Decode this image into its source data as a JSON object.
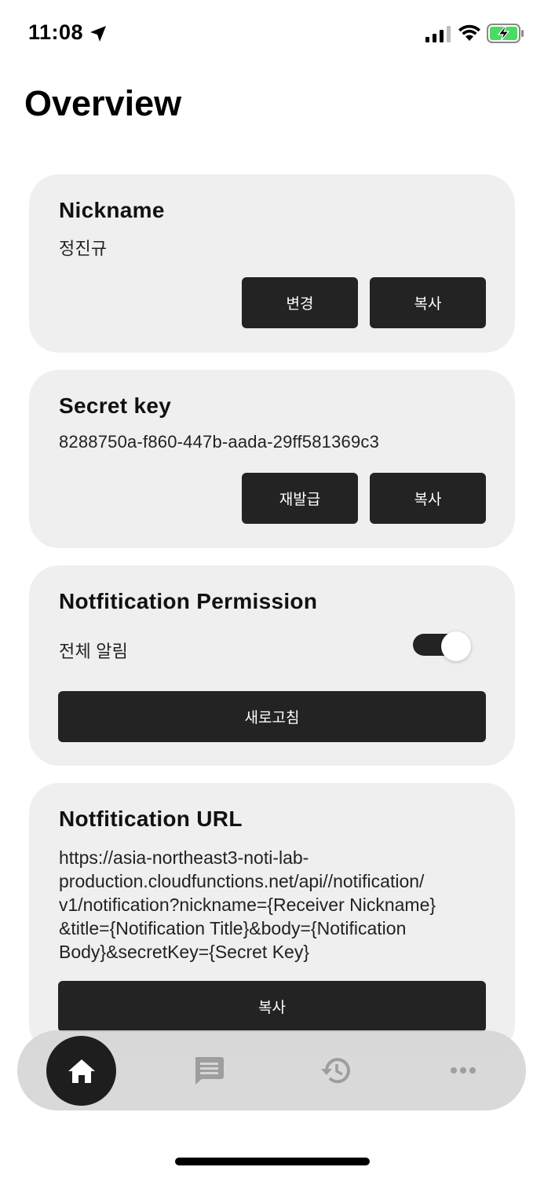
{
  "status_bar": {
    "time": "11:08"
  },
  "page_title": "Overview",
  "nickname_card": {
    "title": "Nickname",
    "value": "정진규",
    "change_label": "변경",
    "copy_label": "복사"
  },
  "secret_card": {
    "title": "Secret key",
    "value": "8288750a-f860-447b-aada-29ff581369c3",
    "reissue_label": "재발급",
    "copy_label": "복사"
  },
  "permission_card": {
    "title": "Notfitication Permission",
    "toggle_label": "전체 알림",
    "toggle_on": true,
    "refresh_label": "새로고침"
  },
  "url_card": {
    "title": "Notfitication URL",
    "url": "https://asia-northeast3-noti-lab-\nproduction.cloudfunctions.net/api//notification/\nv1/notification?nickname={Receiver Nickname}\n&title={Notification Title}&body={Notification\nBody}&secretKey={Secret Key}",
    "copy_label": "복사"
  },
  "bottom_nav": {
    "items": [
      {
        "icon": "home-icon",
        "active": true
      },
      {
        "icon": "chat-icon",
        "active": false
      },
      {
        "icon": "history-icon",
        "active": false
      },
      {
        "icon": "more-icon",
        "active": false
      }
    ]
  },
  "colors": {
    "card_bg": "#efefef",
    "button_bg": "#232323",
    "nav_bg": "#d6d6d6",
    "icon_inactive": "#9e9e9e"
  }
}
